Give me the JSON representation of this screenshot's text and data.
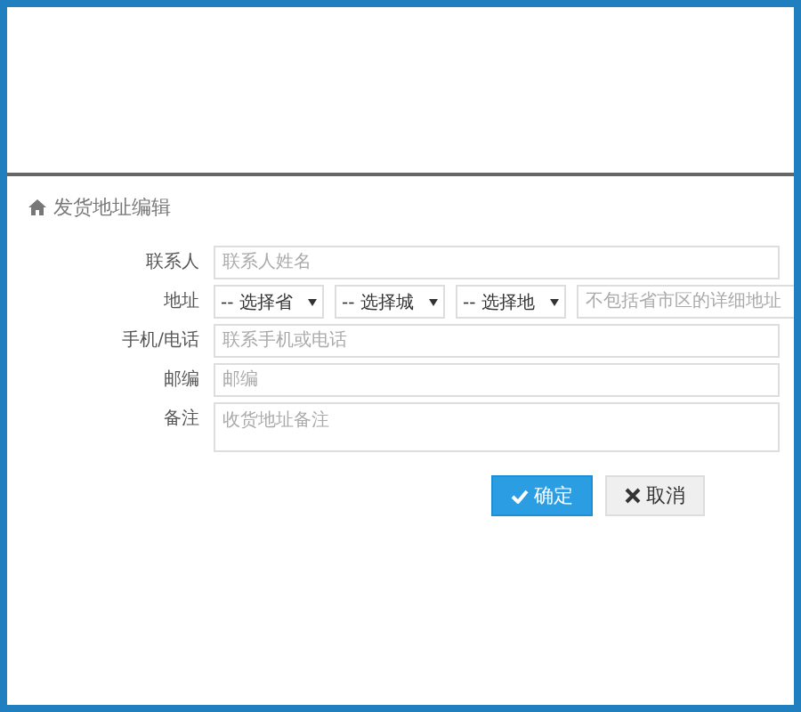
{
  "panel": {
    "title": "发货地址编辑"
  },
  "fields": [
    {
      "kind": "input",
      "label": "联系人",
      "placeholder": "联系人姓名"
    },
    {
      "kind": "address",
      "label": "地址",
      "selects": [
        "-- 选择省",
        "-- 选择城",
        "-- 选择地"
      ],
      "placeholder": "不包括省市区的详细地址"
    },
    {
      "kind": "input",
      "label": "手机/电话",
      "placeholder": "联系手机或电话"
    },
    {
      "kind": "input",
      "label": "邮编",
      "placeholder": "邮编"
    },
    {
      "kind": "textarea",
      "label": "备注",
      "placeholder": "收货地址备注"
    }
  ],
  "buttons": [
    {
      "kind": "primary",
      "label": "确定"
    },
    {
      "kind": "cancel",
      "label": "取消"
    }
  ]
}
